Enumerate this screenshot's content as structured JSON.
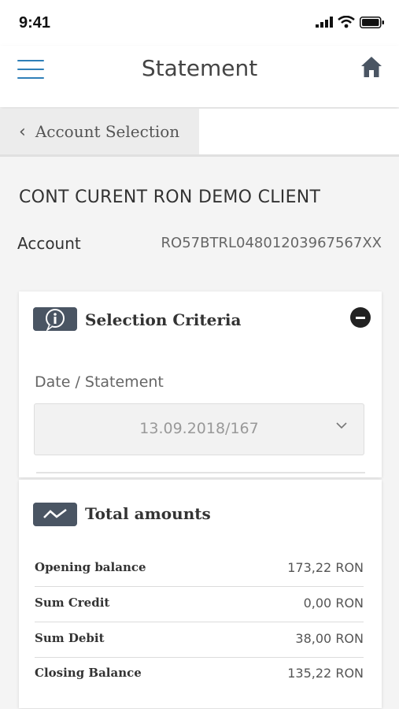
{
  "status_bar": {
    "time": "9:41",
    "icons": [
      "signal-icon",
      "wifi-icon",
      "battery-icon"
    ]
  },
  "nav": {
    "title": "Statement",
    "menu_icon": "hamburger-menu-icon",
    "home_icon": "home-icon"
  },
  "back": {
    "label": "Account Selection",
    "icon": "chevron-left-icon"
  },
  "account": {
    "title": "CONT CURENT RON DEMO CLIENT",
    "label": "Account",
    "number": "RO57BTRL04801203967567XX"
  },
  "criteria": {
    "title": "Selection Criteria",
    "date_label": "Date / Statement",
    "date_value": "13.09.2018/167",
    "icon": "info-bubble-icon",
    "collapse_icon": "minus-circle-icon"
  },
  "totals": {
    "title": "Total amounts",
    "icon": "chart-line-icon",
    "rows": [
      {
        "label": "Opening balance",
        "value": "173,22 RON"
      },
      {
        "label": "Sum Credit",
        "value": "0,00 RON"
      },
      {
        "label": "Sum Debit",
        "value": "38,00 RON"
      },
      {
        "label": "Closing Balance",
        "value": "135,22 RON"
      }
    ]
  },
  "colors": {
    "accent": "#2f7fb8",
    "icon_dark": "#4a5563",
    "background": "#f4f4f4"
  }
}
